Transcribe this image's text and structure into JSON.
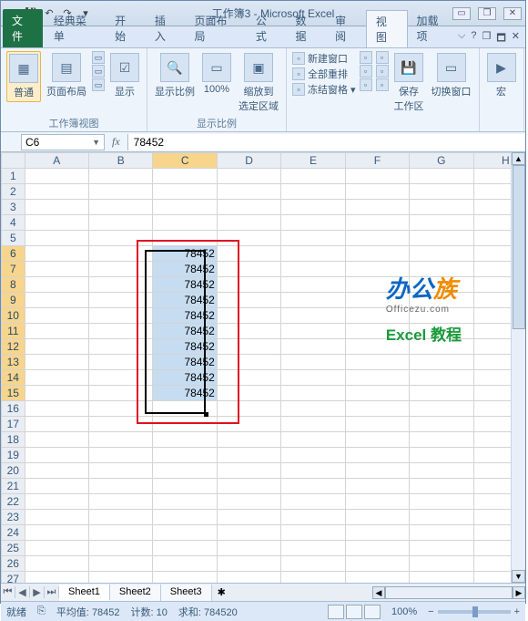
{
  "window": {
    "title": "工作簿3 - Microsoft Excel",
    "app_icon": "X"
  },
  "qat": {
    "save": "💾",
    "undo": "↶",
    "redo": "↷",
    "more": "▾"
  },
  "tabs": {
    "file": "文件",
    "items": [
      "经典菜单",
      "开始",
      "插入",
      "页面布局",
      "公式",
      "数据",
      "审阅",
      "视图",
      "加载项"
    ],
    "active_index": 7,
    "help_icons": [
      "⌵",
      "?",
      "❐",
      "🗖",
      "✕"
    ]
  },
  "ribbon": {
    "group1": {
      "label": "工作簿视图",
      "normal": "普通",
      "pagelayout": "页面布局",
      "show": "显示"
    },
    "group2": {
      "label": "显示比例",
      "zoom": "显示比例",
      "hundred": "100%",
      "zoomsel": "缩放到\n选定区域"
    },
    "group3": {
      "newwin": "新建窗口",
      "arrange": "全部重排",
      "freeze": "冻结窗格"
    },
    "group4": {
      "save_ws": "保存\n工作区",
      "switch": "切换窗口"
    },
    "group5": {
      "macro": "宏"
    }
  },
  "formula": {
    "cellref": "C6",
    "fx": "fx",
    "value": "78452"
  },
  "columns": [
    "A",
    "B",
    "C",
    "D",
    "E",
    "F",
    "G",
    "H"
  ],
  "active_col": "C",
  "rows_count": 28,
  "sel_rows": [
    6,
    7,
    8,
    9,
    10,
    11,
    12,
    13,
    14,
    15
  ],
  "cell_value": "78452",
  "watermark": {
    "brand1": "办公",
    "brand2": "族",
    "url": "Officezu.com",
    "line3": "Excel 教程"
  },
  "sheets": {
    "nav": [
      "⏮",
      "◀",
      "▶",
      "⏭"
    ],
    "items": [
      "Sheet1",
      "Sheet2",
      "Sheet3"
    ],
    "active": 0,
    "add": "✱"
  },
  "status": {
    "ready": "就绪",
    "scroll_lock_icon": "⎘",
    "avg_label": "平均值:",
    "avg": "78452",
    "count_label": "计数:",
    "count": "10",
    "sum_label": "求和:",
    "sum": "784520",
    "zoom": "100%",
    "minus": "−",
    "plus": "+"
  },
  "chart_data": {
    "type": "table",
    "columns": [
      "C"
    ],
    "rows": [
      {
        "row": 6,
        "C": 78452
      },
      {
        "row": 7,
        "C": 78452
      },
      {
        "row": 8,
        "C": 78452
      },
      {
        "row": 9,
        "C": 78452
      },
      {
        "row": 10,
        "C": 78452
      },
      {
        "row": 11,
        "C": 78452
      },
      {
        "row": 12,
        "C": 78452
      },
      {
        "row": 13,
        "C": 78452
      },
      {
        "row": 14,
        "C": 78452
      },
      {
        "row": 15,
        "C": 78452
      }
    ]
  }
}
